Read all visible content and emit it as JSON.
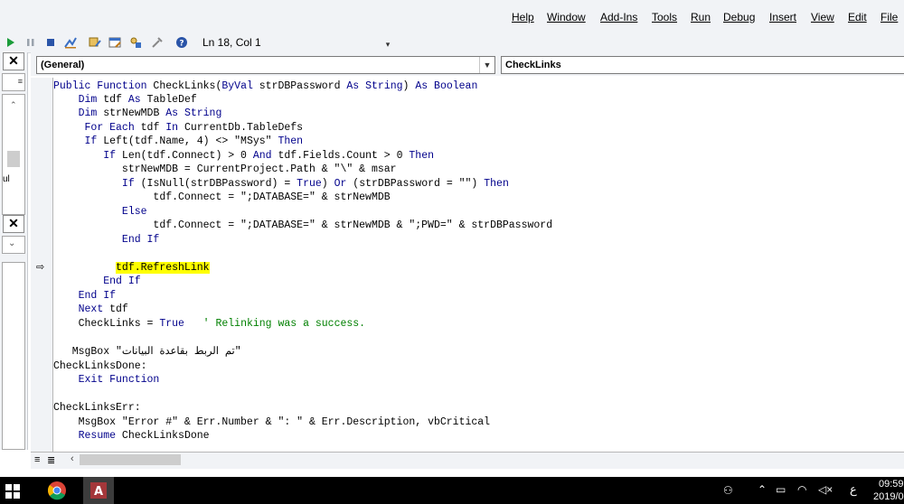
{
  "menubar": {
    "items": [
      "Help",
      "Window",
      "Add-Ins",
      "Tools",
      "Run",
      "Debug",
      "Insert",
      "View",
      "Edit",
      "File"
    ]
  },
  "toolbar": {
    "status": "Ln 18, Col 1"
  },
  "combos": {
    "object": "(General)",
    "procedure": "CheckLinks"
  },
  "code": {
    "lines": [
      "Public Function CheckLinks(ByVal strDBPassword As String) As Boolean",
      "    Dim tdf As TableDef",
      "    Dim strNewMDB As String",
      "     For Each tdf In CurrentDb.TableDefs",
      "     If Left(tdf.Name, 4) <> \"MSys\" Then",
      "        If Len(tdf.Connect) > 0 And tdf.Fields.Count > 0 Then",
      "           strNewMDB = CurrentProject.Path & \"\\\" & msar",
      "           If (IsNull(strDBPassword) = True) Or (strDBPassword = \"\") Then",
      "                tdf.Connect = \";DATABASE=\" & strNewMDB",
      "           Else",
      "                tdf.Connect = \";DATABASE=\" & strNewMDB & \";PWD=\" & strDBPassword",
      "           End If",
      "",
      "          tdf.RefreshLink",
      "        End If",
      "    End If",
      "    Next tdf",
      "    CheckLinks = True   ' Relinking was a success.",
      "",
      "   MsgBox \"تم الربط بقاعدة البيانات\"",
      "CheckLinksDone:",
      "    Exit Function",
      "",
      "CheckLinksErr:",
      "    MsgBox \"Error #\" & Err.Number & \": \" & Err.Description, vbCritical",
      "    Resume CheckLinksDone"
    ]
  },
  "leftstrip": {
    "label_fragment": "ul"
  },
  "taskbar": {
    "time": "09:59",
    "date": "2019/0",
    "lang": "ع"
  },
  "colors": {
    "keyword": "#00008b",
    "comment": "#008000",
    "highlight": "#ffff00"
  }
}
